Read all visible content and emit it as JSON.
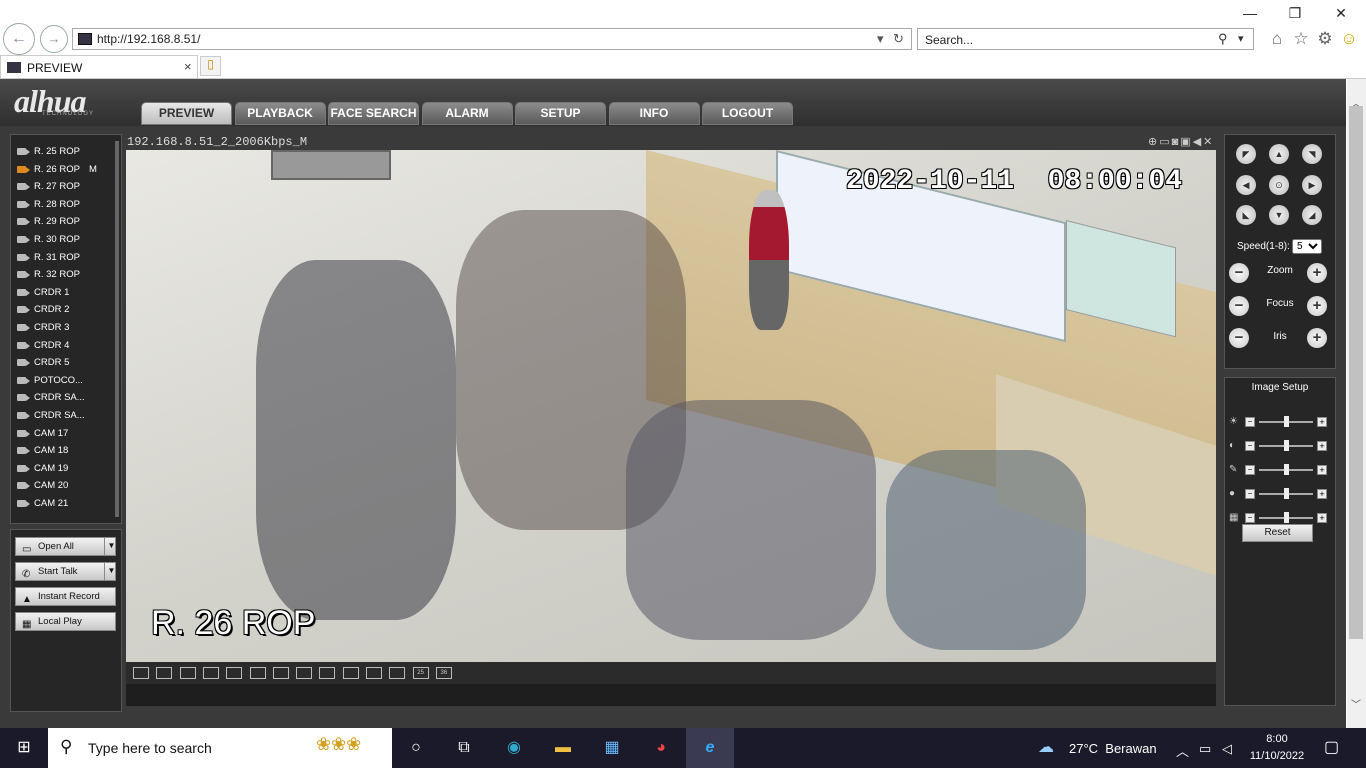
{
  "browser": {
    "address": "http://192.168.8.51/",
    "search_placeholder": "Search...",
    "tab_title": "PREVIEW",
    "win_min": "—",
    "win_restore": "❐",
    "win_close": "✕"
  },
  "app": {
    "logo": "alhua",
    "logo_sub": "TECHNOLOGY",
    "menu": [
      "PREVIEW",
      "PLAYBACK",
      "FACE SEARCH",
      "ALARM",
      "SETUP",
      "INFO",
      "LOGOUT"
    ],
    "active_menu": "PREVIEW"
  },
  "channels": {
    "items": [
      {
        "label": "R. 25 ROP",
        "flag": ""
      },
      {
        "label": "R. 26 ROP",
        "flag": "M"
      },
      {
        "label": "R. 27 ROP",
        "flag": ""
      },
      {
        "label": "R. 28 ROP",
        "flag": ""
      },
      {
        "label": "R. 29 ROP",
        "flag": ""
      },
      {
        "label": "R. 30 ROP",
        "flag": ""
      },
      {
        "label": "R. 31 ROP",
        "flag": ""
      },
      {
        "label": "R. 32 ROP",
        "flag": ""
      },
      {
        "label": "CRDR 1",
        "flag": ""
      },
      {
        "label": "CRDR 2",
        "flag": ""
      },
      {
        "label": "CRDR 3",
        "flag": ""
      },
      {
        "label": "CRDR 4",
        "flag": ""
      },
      {
        "label": "CRDR 5",
        "flag": ""
      },
      {
        "label": "POTOCO...",
        "flag": ""
      },
      {
        "label": "CRDR SA...",
        "flag": ""
      },
      {
        "label": "CRDR SA...",
        "flag": ""
      },
      {
        "label": "CAM 17",
        "flag": ""
      },
      {
        "label": "CAM 18",
        "flag": ""
      },
      {
        "label": "CAM 19",
        "flag": ""
      },
      {
        "label": "CAM 20",
        "flag": ""
      },
      {
        "label": "CAM 21",
        "flag": ""
      }
    ],
    "active_index": 1
  },
  "actions": {
    "open_all": "Open All",
    "start_talk": "Start Talk",
    "instant_record": "Instant Record",
    "local_play": "Local Play"
  },
  "video": {
    "stream_title": "192.168.8.51_2_2006Kbps_M",
    "timestamp": "2022-10-11  08:00:04",
    "channel_label": "R. 26 ROP",
    "layout_buttons": [
      "1",
      "2",
      "3",
      "4",
      "5",
      "6",
      "7",
      "8",
      "9",
      "10",
      "11",
      "12",
      "25",
      "36"
    ]
  },
  "ptz": {
    "speed_label": "Speed(1-8):",
    "speed_value": "5",
    "zoom": "Zoom",
    "focus": "Focus",
    "iris": "Iris"
  },
  "image_setup": {
    "title": "Image Setup",
    "reset": "Reset",
    "sliders": [
      {
        "icon": "brightness-icon",
        "level": 0.5
      },
      {
        "icon": "contrast-icon",
        "level": 0.5
      },
      {
        "icon": "saturation-icon",
        "level": 0.5
      },
      {
        "icon": "hue-icon",
        "level": 0.5
      },
      {
        "icon": "sharpness-icon",
        "level": 0.5
      }
    ]
  },
  "taskbar": {
    "search_placeholder": "Type here to search",
    "weather": "27°C  Berawan",
    "time": "8:00",
    "date": "11/10/2022"
  }
}
